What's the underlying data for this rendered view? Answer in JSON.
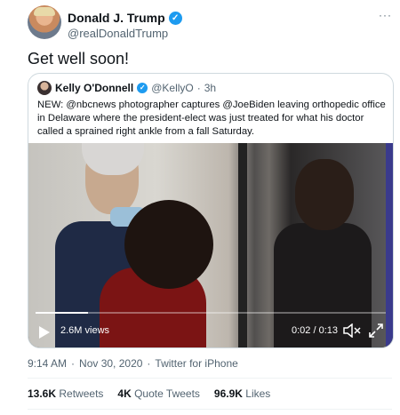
{
  "tweet": {
    "display_name": "Donald J. Trump",
    "handle": "@realDonaldTrump",
    "more_icon": "···",
    "text": "Get well soon!",
    "verified_icon": "check",
    "meta": {
      "time": "9:14 AM",
      "separator": "·",
      "date": "Nov 30, 2020",
      "source": "Twitter for iPhone"
    },
    "stats": {
      "retweets_count": "13.6K",
      "retweets_label": "Retweets",
      "quote_count": "4K",
      "quote_label": "Quote Tweets",
      "likes_count": "96.9K",
      "likes_label": "Likes"
    }
  },
  "quote": {
    "display_name": "Kelly O'Donnell",
    "handle": "@KellyO",
    "separator": "·",
    "time_ago": "3h",
    "text": "NEW: @nbcnews photographer captures @JoeBiden leaving orthopedic office in Delaware where the president-elect was just treated for what his doctor called a sprained right ankle from a fall Saturday.",
    "video": {
      "views": "2.6M views",
      "time": "0:02 / 0:13",
      "progress_fraction": 0.15
    }
  },
  "colors": {
    "accent": "#1d9bf0",
    "text_primary": "#0f1419",
    "text_secondary": "#536471",
    "border": "#cfd9de"
  }
}
